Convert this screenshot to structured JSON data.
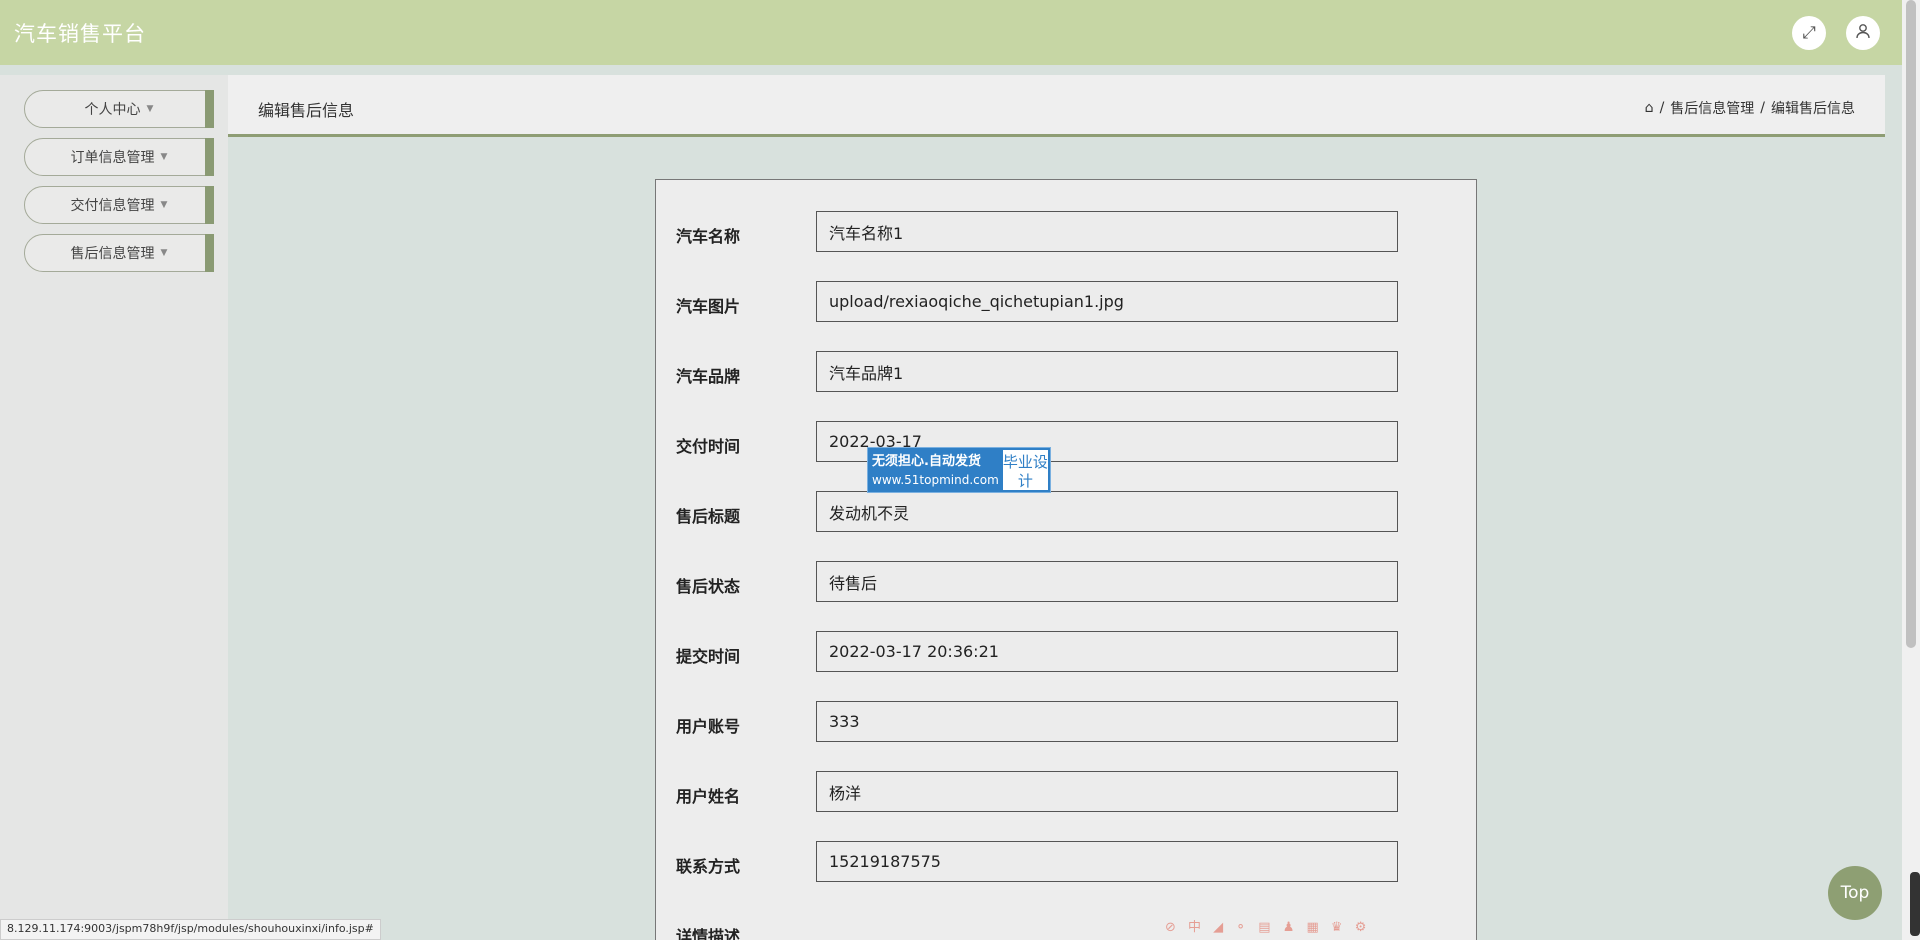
{
  "header": {
    "brand": "汽车销售平台",
    "fullscreen_icon": "expand-icon",
    "user_icon": "user-icon"
  },
  "sidebar": {
    "items": [
      {
        "label": "个人中心"
      },
      {
        "label": "订单信息管理"
      },
      {
        "label": "交付信息管理"
      },
      {
        "label": "售后信息管理"
      }
    ]
  },
  "page": {
    "title": "编辑售后信息",
    "breadcrumb": [
      "售后信息管理",
      "编辑售后信息"
    ]
  },
  "form": {
    "fields": [
      {
        "label": "汽车名称",
        "value": "汽车名称1"
      },
      {
        "label": "汽车图片",
        "value": "upload/rexiaoqiche_qichetupian1.jpg"
      },
      {
        "label": "汽车品牌",
        "value": "汽车品牌1"
      },
      {
        "label": "交付时间",
        "value": "2022-03-17"
      },
      {
        "label": "售后标题",
        "value": "发动机不灵"
      },
      {
        "label": "售后状态",
        "value": "待售后"
      },
      {
        "label": "提交时间",
        "value": "2022-03-17 20:36:21"
      },
      {
        "label": "用户账号",
        "value": "333"
      },
      {
        "label": "用户姓名",
        "value": "杨洋"
      },
      {
        "label": "联系方式",
        "value": "15219187575"
      },
      {
        "label": "详情描述",
        "value": ""
      }
    ]
  },
  "ad": {
    "line1": "无须担心.自动发货",
    "line2": "www.51topmind.com",
    "badge": "毕业设计"
  },
  "top_button": "Top",
  "status_url": "8.129.11.174:9003/jspm78h9f/jsp/modules/shouhouxinxi/info.jsp#"
}
